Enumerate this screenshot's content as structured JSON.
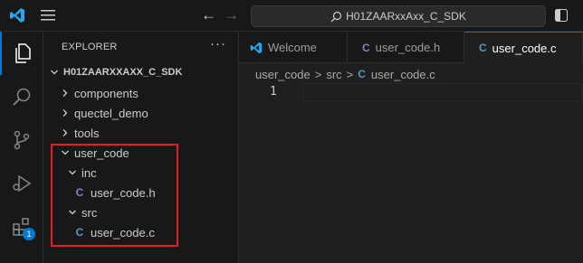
{
  "titlebar": {
    "search_text": "H01ZAARxxAxx_C_SDK"
  },
  "activity": {
    "extensions_badge": "1"
  },
  "explorer": {
    "title": "EXPLORER",
    "more": "···",
    "root": "H01ZAARXXAXX_C_SDK",
    "items": [
      {
        "label": "components"
      },
      {
        "label": "quectel_demo"
      },
      {
        "label": "tools"
      },
      {
        "label": "user_code"
      },
      {
        "label": "inc"
      },
      {
        "label": "user_code.h",
        "icon": "C"
      },
      {
        "label": "src"
      },
      {
        "label": "user_code.c",
        "icon": "C"
      }
    ]
  },
  "tabs": [
    {
      "label": "Welcome"
    },
    {
      "label": "user_code.h",
      "icon": "C"
    },
    {
      "label": "user_code.c",
      "icon": "C"
    }
  ],
  "breadcrumb": {
    "folder1": "user_code",
    "sep": ">",
    "folder2": "src",
    "file_icon": "C",
    "file": "user_code.c"
  },
  "editor": {
    "line_number": "1"
  },
  "colors": {
    "accent": "#0078d4",
    "header_c": "#a074c4",
    "source_c": "#519aba",
    "highlight": "#e51c23"
  }
}
